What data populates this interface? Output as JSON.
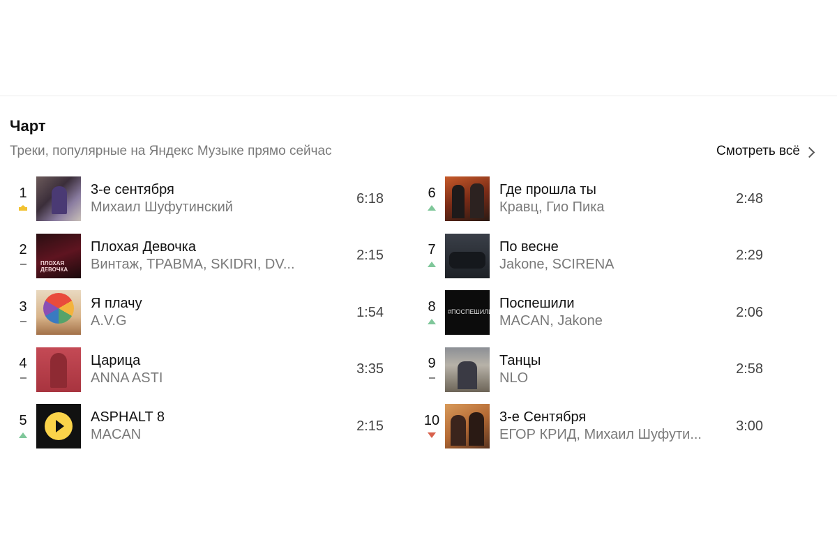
{
  "section": {
    "title": "Чарт",
    "subtitle": "Треки, популярные на Яндекс Музыке прямо сейчас",
    "see_all": "Смотреть всё"
  },
  "tracks": [
    {
      "rank": "1",
      "trend": "crown",
      "title": "3-е сентября",
      "artist": "Михаил Шуфутинский",
      "duration": "6:18"
    },
    {
      "rank": "2",
      "trend": "same",
      "title": "Плохая Девочка",
      "artist": "Винтаж, ТРАВМА, SKIDRI, DV...",
      "duration": "2:15"
    },
    {
      "rank": "3",
      "trend": "same",
      "title": "Я плачу",
      "artist": "A.V.G",
      "duration": "1:54"
    },
    {
      "rank": "4",
      "trend": "same",
      "title": "Царица",
      "artist": "ANNA ASTI",
      "duration": "3:35"
    },
    {
      "rank": "5",
      "trend": "up",
      "title": "ASPHALT 8",
      "artist": "MACAN",
      "duration": "2:15"
    },
    {
      "rank": "6",
      "trend": "up",
      "title": "Где прошла ты",
      "artist": "Кравц, Гио Пика",
      "duration": "2:48"
    },
    {
      "rank": "7",
      "trend": "up",
      "title": "По весне",
      "artist": "Jakone, SCIRENA",
      "duration": "2:29"
    },
    {
      "rank": "8",
      "trend": "up",
      "title": "Поспешили",
      "artist": "MACAN, Jakone",
      "duration": "2:06"
    },
    {
      "rank": "9",
      "trend": "same",
      "title": "Танцы",
      "artist": "NLO",
      "duration": "2:58"
    },
    {
      "rank": "10",
      "trend": "down",
      "title": "3-е Сентября",
      "artist": "ЕГОР КРИД, Михаил Шуфути...",
      "duration": "3:00"
    }
  ],
  "cover_texts": {
    "c2": "ПЛОХАЯ ДЕВОЧКА",
    "c8": "#ПОСПЕШИЛИ..."
  },
  "colors": {
    "trend_up": "#7fc79a",
    "trend_down": "#d8614c",
    "crown": "#f2c230",
    "play_button": "#fbd34a"
  }
}
